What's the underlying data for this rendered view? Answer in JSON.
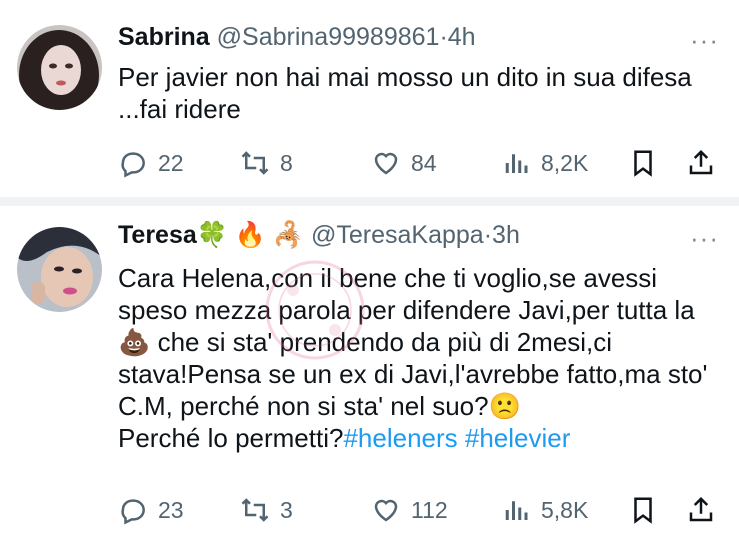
{
  "tweets": [
    {
      "name": "Sabrina",
      "handle": "@Sabrina99989861",
      "sep": "·",
      "time": "4h",
      "text": "Per javier non hai mai mosso un dito in sua difesa ...fai ridere",
      "replies": "22",
      "retweets": "8",
      "likes": "84",
      "views": "8,2K"
    },
    {
      "name": "Teresa",
      "name_emojis": "🍀 🔥 🦂",
      "handle": "@TeresaKappa",
      "sep": "·",
      "time": "3h",
      "text_part1": "Cara Helena,con il bene che ti voglio,se avessi speso mezza parola per difendere Javi,per tutta la ",
      "emoji_poop": "💩",
      "text_part2": " che si sta' prendendo da più di 2mesi,ci stava!Pensa se un ex di Javi,l'avrebbe fatto,ma sto' C.M, perché non si sta' nel suo?",
      "emoji_face": "🙁",
      "text_part3": "Perché lo permetti?",
      "hashtags": [
        "#heleners",
        "#helevier"
      ],
      "replies": "23",
      "retweets": "3",
      "likes": "112",
      "views": "5,8K"
    }
  ],
  "more_glyph": "···",
  "icons": [
    "reply-icon",
    "retweet-icon",
    "like-icon",
    "views-icon",
    "bookmark-icon",
    "share-icon"
  ],
  "colors": {
    "text": "#0f1419",
    "secondary": "#536471",
    "link": "#1d9bf0",
    "separator": "#eff3f4"
  }
}
